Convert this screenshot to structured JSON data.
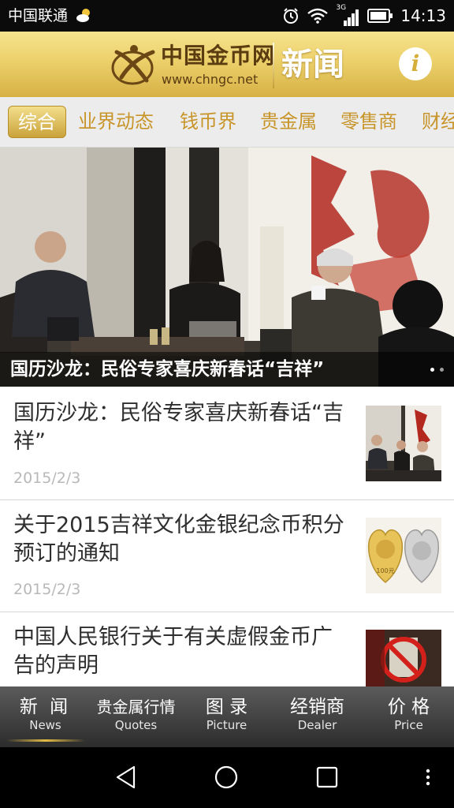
{
  "status_bar": {
    "carrier": "中国联通",
    "network": "3G",
    "time": "14:13"
  },
  "header": {
    "logo_cn": "中国金币网",
    "logo_url": "www.chngc.net",
    "title": "新闻",
    "info_icon": "i"
  },
  "tabs": [
    {
      "label": "综合",
      "active": true
    },
    {
      "label": "业界动态",
      "active": false
    },
    {
      "label": "钱币界",
      "active": false
    },
    {
      "label": "贵金属",
      "active": false
    },
    {
      "label": "零售商",
      "active": false
    },
    {
      "label": "财经",
      "active": false
    }
  ],
  "hero": {
    "caption": "国历沙龙：民俗专家喜庆新春话“吉祥”"
  },
  "news": [
    {
      "title": "国历沙龙：民俗专家喜庆新春话“吉祥”",
      "date": "2015/2/3"
    },
    {
      "title": "关于2015吉祥文化金银纪念币积分预订的通知",
      "date": "2015/2/3",
      "coin_value": "100元"
    },
    {
      "title": "中国人民银行关于有关虚假金币广告的声明",
      "date": ""
    }
  ],
  "bottom_nav": [
    {
      "cn": "新 闻",
      "en": "News",
      "active": true
    },
    {
      "cn": "贵金属行情",
      "en": "Quotes",
      "active": false
    },
    {
      "cn": "图 录",
      "en": "Picture",
      "active": false
    },
    {
      "cn": "经销商",
      "en": "Dealer",
      "active": false
    },
    {
      "cn": "价 格",
      "en": "Price",
      "active": false
    }
  ],
  "colors": {
    "header_gold": "#ecd06a",
    "tab_text": "#c8952a",
    "title_text": "#2e2e2e",
    "date_text": "#b8b8b8"
  }
}
